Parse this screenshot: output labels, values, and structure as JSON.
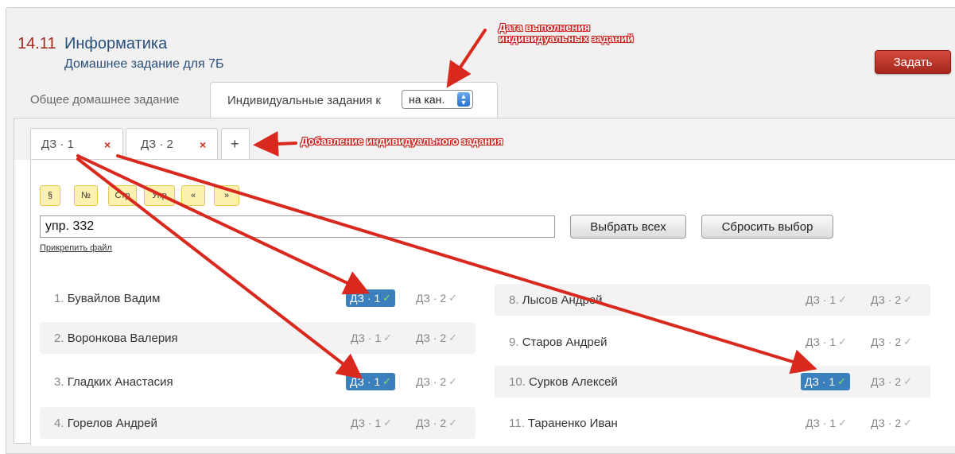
{
  "lesson": {
    "number": "14.11",
    "subject": "Информатика",
    "homework_title": "Домашнее задание для 7Б"
  },
  "assign_button": "Задать",
  "main_tabs": {
    "general": "Общее домашнее задание",
    "individual": "Индивидуальные задания к",
    "date_select_value": "на кан."
  },
  "hw_tabs": [
    {
      "label": "ДЗ · 1",
      "close": "×"
    },
    {
      "label": "ДЗ · 2",
      "close": "×"
    }
  ],
  "add_tab": "+",
  "format_buttons": [
    "§",
    "№",
    "Стр",
    "Упр",
    "«",
    "»"
  ],
  "task_input_value": "упр. 332",
  "attach_file": "Прикрепить файл",
  "select_all": "Выбрать всех",
  "reset_selection": "Сбросить выбор",
  "chip_labels": [
    "ДЗ · 1",
    "ДЗ · 2"
  ],
  "check_mark": "✓",
  "students_left": [
    {
      "num": "1.",
      "name": "Бувайлов Вадим",
      "dz1": true,
      "dz2": false
    },
    {
      "num": "2.",
      "name": "Воронкова Валерия",
      "dz1": false,
      "dz2": false
    },
    {
      "num": "3.",
      "name": "Гладких Анастасия",
      "dz1": true,
      "dz2": false
    },
    {
      "num": "4.",
      "name": "Горелов Андрей",
      "dz1": false,
      "dz2": false
    }
  ],
  "students_right": [
    {
      "num": "8.",
      "name": "Лысов Андрей",
      "dz1": false,
      "dz2": false
    },
    {
      "num": "9.",
      "name": "Старов Андрей",
      "dz1": false,
      "dz2": false
    },
    {
      "num": "10.",
      "name": "Сурков Алексей",
      "dz1": true,
      "dz2": false
    },
    {
      "num": "11.",
      "name": "Тараненко Иван",
      "dz1": false,
      "dz2": false
    }
  ],
  "annotations": {
    "due_date_line1": "Дата выполнения",
    "due_date_line2": "индивидуальных заданий",
    "add_task": "Добавление индивидуального задания"
  },
  "colors": {
    "accent_red": "#a5261d",
    "link_blue": "#2a4f79",
    "chip_active": "#3c7fbd",
    "annotation_red": "#d9281e"
  }
}
